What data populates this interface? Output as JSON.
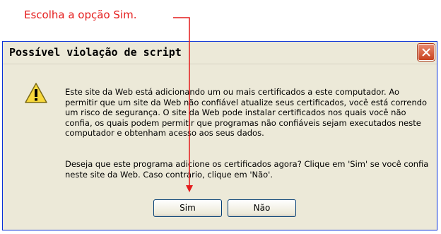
{
  "annotation": {
    "text": "Escolha a opção Sim.",
    "color": "#e41b1b"
  },
  "dialog": {
    "title": "Possível violação de script",
    "close_icon": "close-icon",
    "warning_icon": "warning-icon",
    "message": "Este site da Web está adicionando um ou mais certificados a este computador. Ao permitir que um site da Web não confiável atualize seus certificados, você está correndo um risco de segurança. O site da Web pode instalar certificados nos quais você não confia, os quais podem permitir que programas não confiáveis sejam executados neste computador e obtenham acesso aos seus dados.",
    "question": "Deseja que este programa adicione os certificados agora? Clique em 'Sim' se você confia neste site da Web. Caso contrário, clique em 'Não'.",
    "buttons": {
      "yes_label": "Sim",
      "no_label": "Não"
    }
  }
}
